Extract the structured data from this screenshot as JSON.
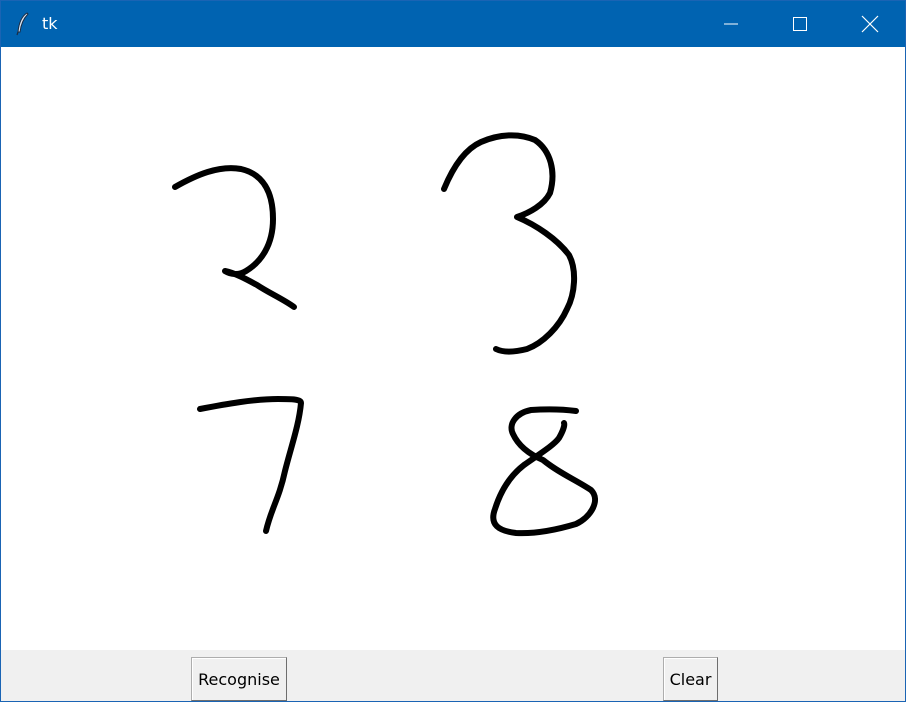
{
  "window": {
    "title": "tk",
    "app_icon": "feather-icon",
    "controls": {
      "minimize_icon": "minimize-icon",
      "maximize_icon": "maximize-icon",
      "close_icon": "close-icon"
    },
    "titlebar_color": "#0063b1"
  },
  "canvas": {
    "background": "#ffffff",
    "stroke_color": "#000000",
    "drawn_digits": [
      "2",
      "3",
      "7",
      "8"
    ]
  },
  "buttons": {
    "recognise_label": "Recognise",
    "clear_label": "Clear"
  }
}
